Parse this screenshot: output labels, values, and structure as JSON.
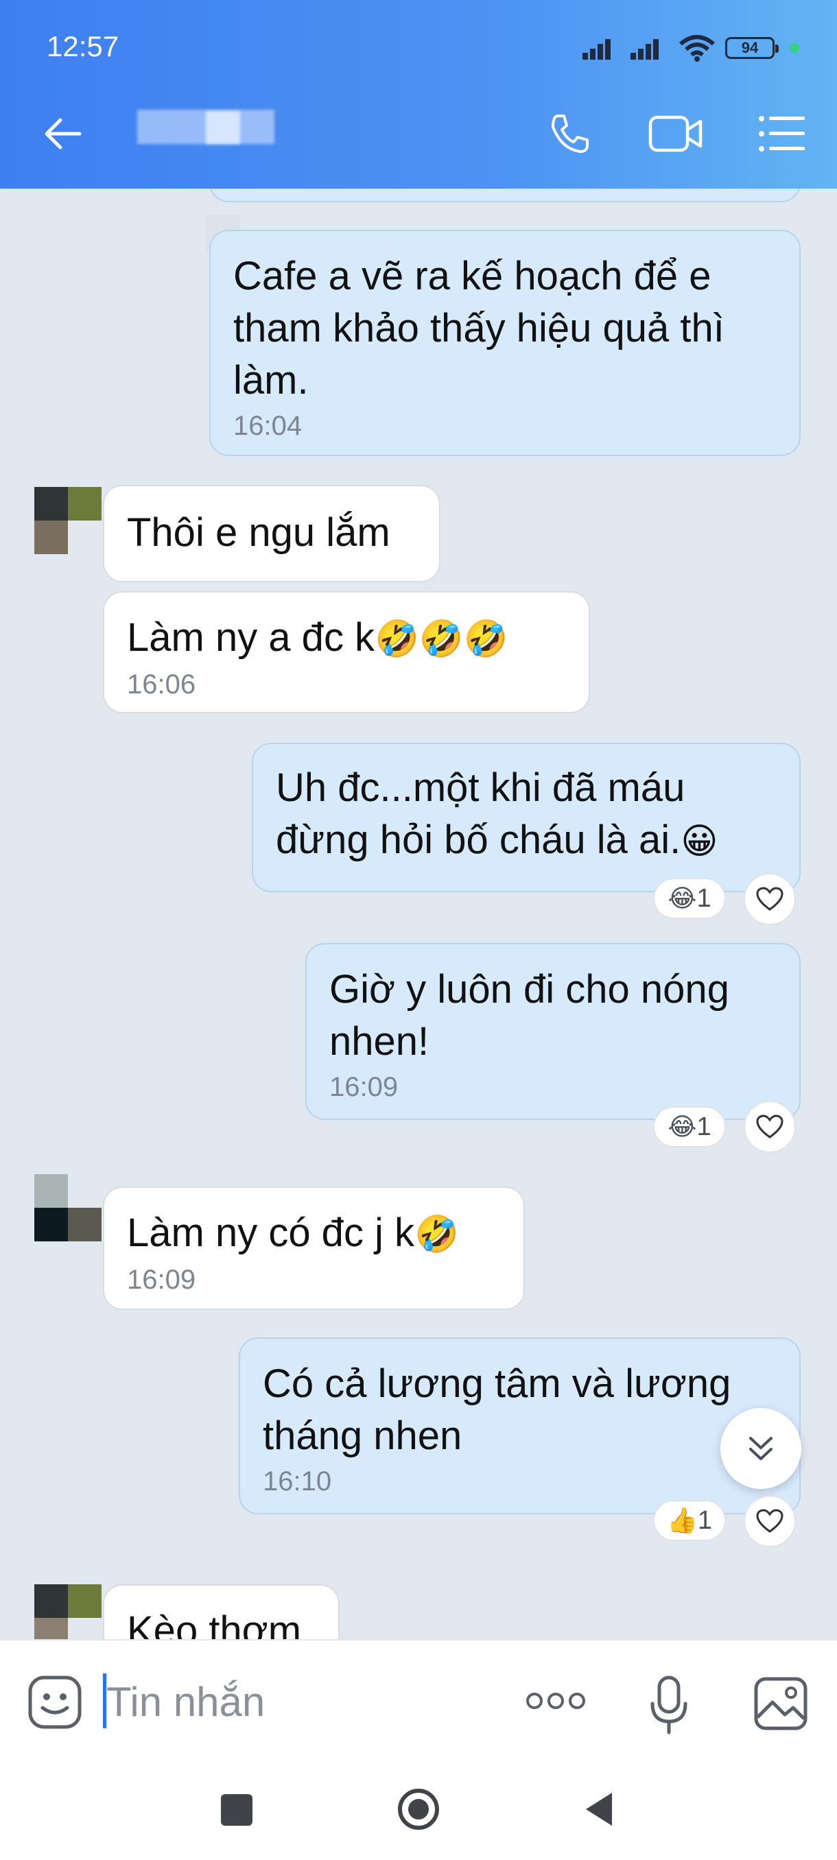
{
  "status_bar": {
    "time": "12:57",
    "battery": "94"
  },
  "header": {
    "contact_name": ""
  },
  "messages": [
    {
      "text": "Cafe a vẽ ra kế hoạch để e tham khảo thấy hiệu quả thì làm.",
      "time": "16:04"
    },
    {
      "text": "Thôi e ngu lắm"
    },
    {
      "text": "Làm ny a đc k",
      "emoji": "🤣🤣🤣",
      "time": "16:06"
    },
    {
      "text": "Uh đc...một khi đã máu đừng hỏi bố cháu là ai.",
      "emoji": "😀",
      "reaction": {
        "emoji": "😂",
        "count": "1"
      }
    },
    {
      "text": "Giờ y luôn đi cho nóng nhen!",
      "time": "16:09",
      "reaction": {
        "emoji": "😂",
        "count": "1"
      }
    },
    {
      "text": "Làm ny có đc j k",
      "emoji": "🤣",
      "time": "16:09"
    },
    {
      "text": "Có cả lương tâm và lương tháng nhen",
      "time": "16:10",
      "reaction": {
        "emoji": "👍",
        "count": "1"
      }
    },
    {
      "text": "Kèo thơm"
    }
  ],
  "input": {
    "placeholder": "Tin nhắn"
  },
  "colors": {
    "header_start": "#3d7ff0",
    "header_end": "#62b4f4",
    "outgoing_bubble": "#d6eafc",
    "incoming_bubble": "#ffffff",
    "background": "#e2e8ef"
  }
}
